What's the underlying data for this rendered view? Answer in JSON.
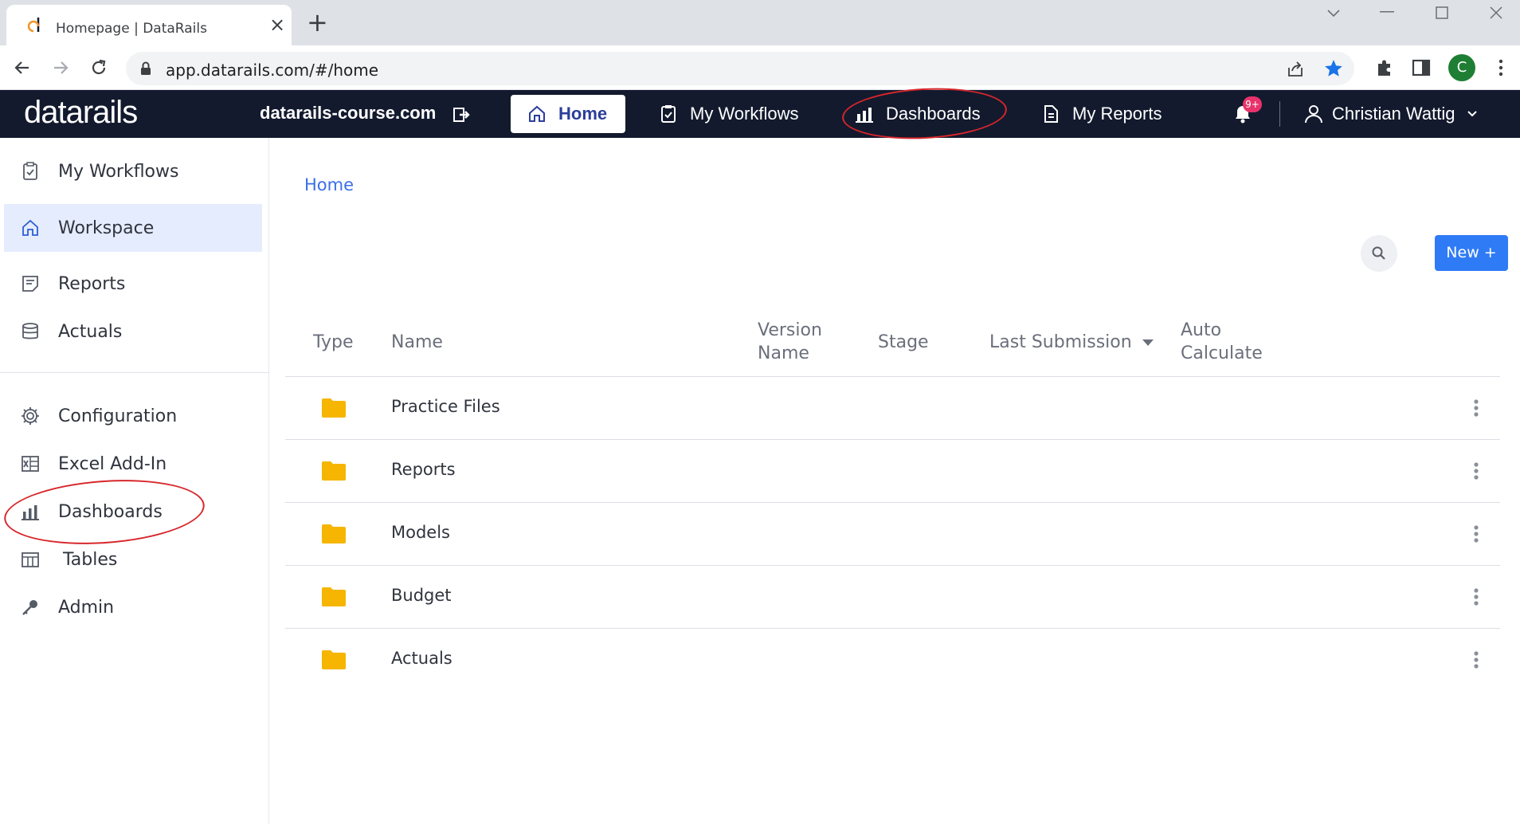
{
  "browser": {
    "tab_title": "Homepage | DataRails",
    "url": "app.datarails.com/#/home",
    "profile_initial": "C",
    "window_controls": [
      "chevron-down",
      "minimize",
      "maximize",
      "close"
    ]
  },
  "header": {
    "logo": "datarails",
    "domain": "datarails-course.com",
    "nav": {
      "home": "Home",
      "workflows": "My Workflows",
      "dashboards": "Dashboards",
      "reports": "My Reports"
    },
    "notification_badge": "9+",
    "user_name": "Christian Wattig"
  },
  "sidebar": {
    "top_items": [
      {
        "label": "My Workflows",
        "icon": "clipboard-check-icon"
      },
      {
        "label": "Workspace",
        "icon": "home-icon",
        "active": true
      },
      {
        "label": "Reports",
        "icon": "report-icon"
      },
      {
        "label": "Actuals",
        "icon": "database-icon"
      }
    ],
    "bottom_items": [
      {
        "label": "Configuration",
        "icon": "gear-icon"
      },
      {
        "label": "Excel Add-In",
        "icon": "excel-icon"
      },
      {
        "label": "Dashboards",
        "icon": "bar-chart-icon"
      },
      {
        "label": "Tables",
        "icon": "table-icon"
      },
      {
        "label": "Admin",
        "icon": "key-icon"
      }
    ]
  },
  "main": {
    "breadcrumb": "Home",
    "new_button": "New +",
    "columns": {
      "type": "Type",
      "name": "Name",
      "version_line1": "Version",
      "version_line2": "Name",
      "stage": "Stage",
      "last_submission": "Last Submission",
      "auto_line1": "Auto",
      "auto_line2": "Calculate"
    },
    "rows": [
      {
        "name": "Practice Files"
      },
      {
        "name": "Reports"
      },
      {
        "name": "Models"
      },
      {
        "name": "Budget"
      },
      {
        "name": "Actuals"
      }
    ]
  },
  "colors": {
    "header_bg": "#131a2e",
    "accent_blue": "#2f7bf5",
    "link_blue": "#3a6ee8",
    "folder_yellow": "#f5b500",
    "annotation_red": "#d7262b",
    "sidebar_active": "#e5ecfd"
  }
}
